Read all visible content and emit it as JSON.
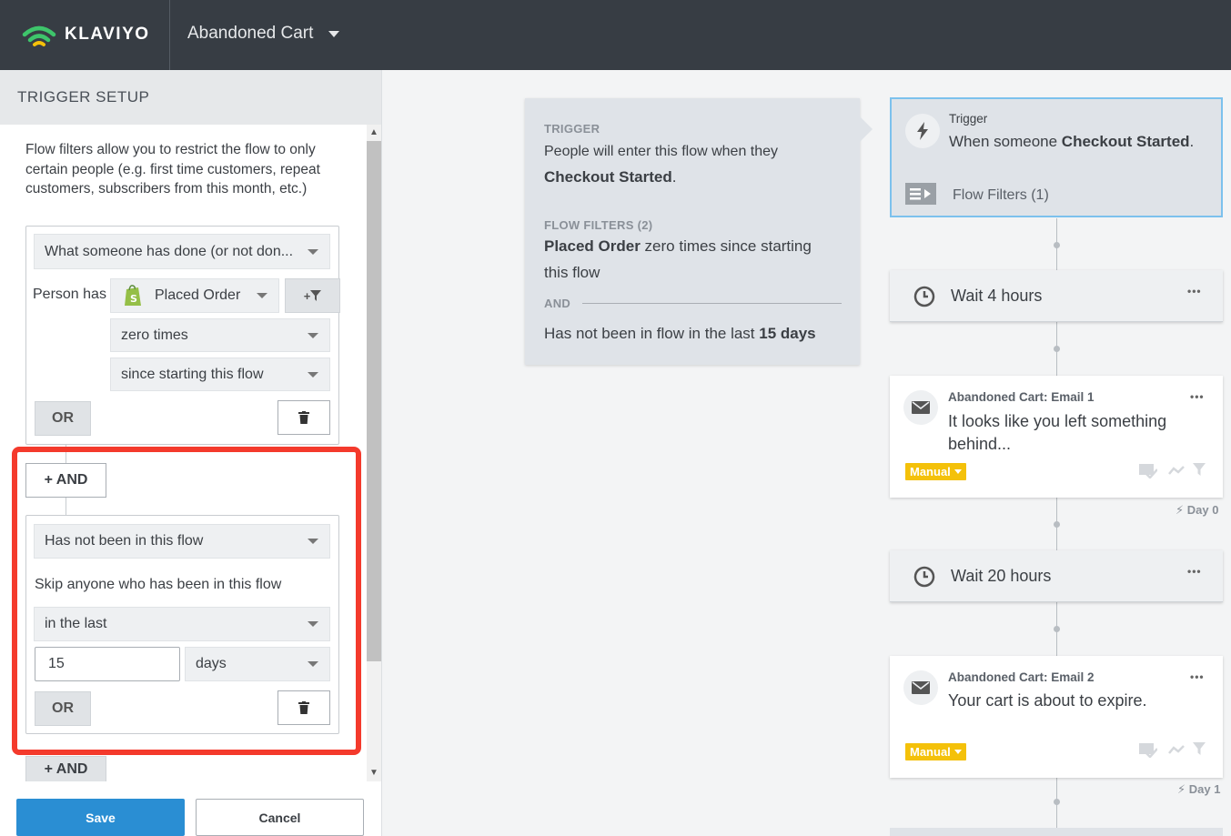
{
  "header": {
    "brand": "KLAVIYO",
    "flow_name": "Abandoned Cart"
  },
  "left_panel": {
    "title": "TRIGGER SETUP",
    "intro": "Flow filters allow you to restrict the flow to only certain people (e.g. first time customers, repeat customers, subscribers from this month, etc.)",
    "filter1": {
      "type_select": "What someone has done (or not don...",
      "person_has_label": "Person has",
      "event_select": "Placed Order",
      "frequency_select": "zero times",
      "timeframe_select": "since starting this flow",
      "or_label": "OR",
      "add_filter_label": "+"
    },
    "and_label": "+ AND",
    "filter2": {
      "type_select": "Has not been in this flow",
      "description": "Skip anyone who has been in this flow",
      "timeframe_select": "in the last",
      "number_value": "15",
      "unit_select": "days",
      "or_label": "OR"
    },
    "and_label_bottom": "+ AND",
    "save_label": "Save",
    "cancel_label": "Cancel"
  },
  "summary": {
    "trigger_heading": "TRIGGER",
    "trigger_text_1": "People will enter this flow when they",
    "trigger_event": "Checkout Started",
    "trigger_period": ".",
    "filters_heading": "FLOW FILTERS (2)",
    "filter1_bold": "Placed Order",
    "filter1_rest": " zero times since starting",
    "filter1_line2": "this flow",
    "and_heading": "AND",
    "filter2_text": "Has not been in flow in the last ",
    "filter2_bold": "15 days"
  },
  "flow": {
    "trigger_node": {
      "label": "Trigger",
      "text_prefix": "When someone ",
      "event": "Checkout Started",
      "text_suffix": ".",
      "filters_link": "Flow Filters (1)"
    },
    "wait1": {
      "label": "Wait 4 hours"
    },
    "email1": {
      "label": "Abandoned Cart: Email 1",
      "subject": "It looks like you left something behind...",
      "badge": "Manual",
      "day": "Day 0"
    },
    "wait2": {
      "label": "Wait 20 hours"
    },
    "email2": {
      "label": "Abandoned Cart: Email 2",
      "subject": "Your cart is about to expire.",
      "badge": "Manual",
      "day": "Day 1"
    },
    "more_label": "•••"
  },
  "colors": {
    "topbar": "#373d44",
    "highlight": "#f43a2c",
    "primary": "#2a8ed3",
    "manual_badge": "#f4c10a",
    "trigger_border": "#7cc1ed"
  }
}
